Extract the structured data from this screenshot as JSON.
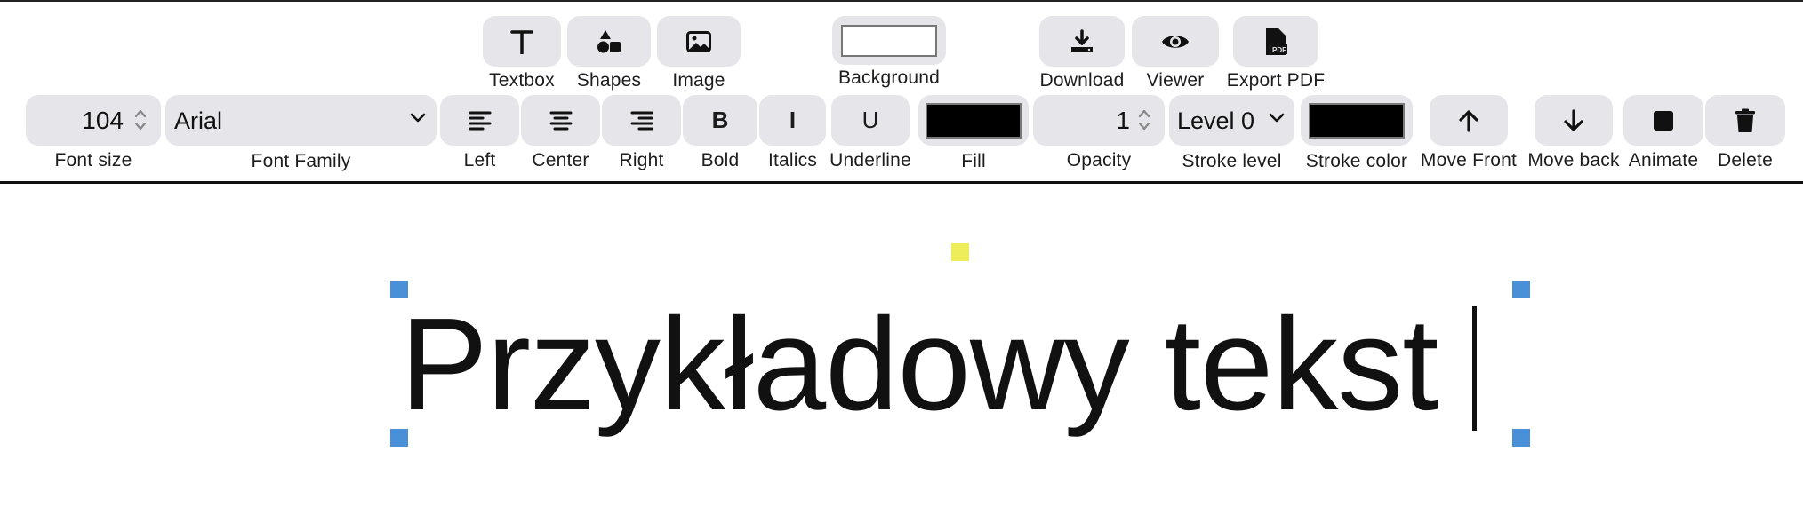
{
  "insert_tools": [
    {
      "id": "textbox",
      "label": "Textbox",
      "icon": "text-icon"
    },
    {
      "id": "shapes",
      "label": "Shapes",
      "icon": "shapes-icon"
    },
    {
      "id": "image",
      "label": "Image",
      "icon": "image-icon"
    }
  ],
  "background": {
    "label": "Background",
    "color": "#ffffff"
  },
  "export_tools": [
    {
      "id": "download",
      "label": "Download",
      "icon": "download-icon"
    },
    {
      "id": "viewer",
      "label": "Viewer",
      "icon": "eye-icon"
    },
    {
      "id": "export_pdf",
      "label": "Export PDF",
      "icon": "pdf-file-icon"
    }
  ],
  "font_size": {
    "label": "Font size",
    "value": "104"
  },
  "font_family": {
    "label": "Font Family",
    "value": "Arial"
  },
  "align": {
    "left": {
      "label": "Left",
      "icon": "align-left-icon"
    },
    "center": {
      "label": "Center",
      "icon": "align-center-icon"
    },
    "right": {
      "label": "Right",
      "icon": "align-right-icon"
    }
  },
  "style": {
    "bold": {
      "label": "Bold",
      "glyph": "B"
    },
    "italics": {
      "label": "Italics",
      "glyph": "I"
    },
    "underline": {
      "label": "Underline",
      "glyph": "U"
    }
  },
  "fill": {
    "label": "Fill",
    "color": "#000000"
  },
  "opacity": {
    "label": "Opacity",
    "value": "1"
  },
  "stroke_level": {
    "label": "Stroke level",
    "value": "Level 0"
  },
  "stroke_color": {
    "label": "Stroke color",
    "color": "#000000"
  },
  "move_front": {
    "label": "Move Front",
    "icon": "arrow-up-icon"
  },
  "move_back": {
    "label": "Move back",
    "icon": "arrow-down-icon"
  },
  "animate": {
    "label": "Animate",
    "icon": "square-stop-icon"
  },
  "delete": {
    "label": "Delete",
    "icon": "trash-icon"
  },
  "canvas": {
    "text": "Przykładowy tekst",
    "selection_color": "#4a90d9",
    "rotate_handle_color": "#eded5c"
  }
}
